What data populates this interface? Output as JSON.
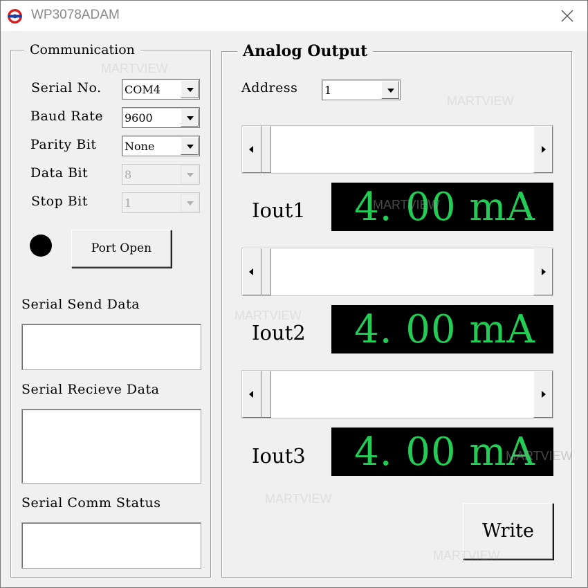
{
  "window": {
    "title": "WP3078ADAM"
  },
  "communication": {
    "group_title": "Communication",
    "serial_no": {
      "label": "Serial No.",
      "value": "COM4"
    },
    "baud_rate": {
      "label": "Baud Rate",
      "value": "9600"
    },
    "parity_bit": {
      "label": "Parity Bit",
      "value": "None"
    },
    "data_bit": {
      "label": "Data Bit",
      "value": "8"
    },
    "stop_bit": {
      "label": "Stop Bit",
      "value": "1"
    },
    "status_led_color": "#000000",
    "port_button_label": "Port Open",
    "send_data": {
      "label": "Serial Send Data",
      "value": ""
    },
    "receive_data": {
      "label": "Serial Recieve Data",
      "value": ""
    },
    "comm_status": {
      "label": "Serial Comm Status",
      "value": ""
    }
  },
  "analog_output": {
    "group_title": "Analog Output",
    "address": {
      "label": "Address",
      "value": "1"
    },
    "channels": [
      {
        "label": "Iout1",
        "readout": "4. 00 mA",
        "slider_level": 0
      },
      {
        "label": "Iout2",
        "readout": "4. 00 mA",
        "slider_level": 0
      },
      {
        "label": "Iout3",
        "readout": "4. 00 mA",
        "slider_level": 0
      }
    ],
    "display_colors": {
      "background": "#000000",
      "text": "#22cc55"
    },
    "write_button_label": "Write"
  },
  "watermark": "MARTVIEW"
}
